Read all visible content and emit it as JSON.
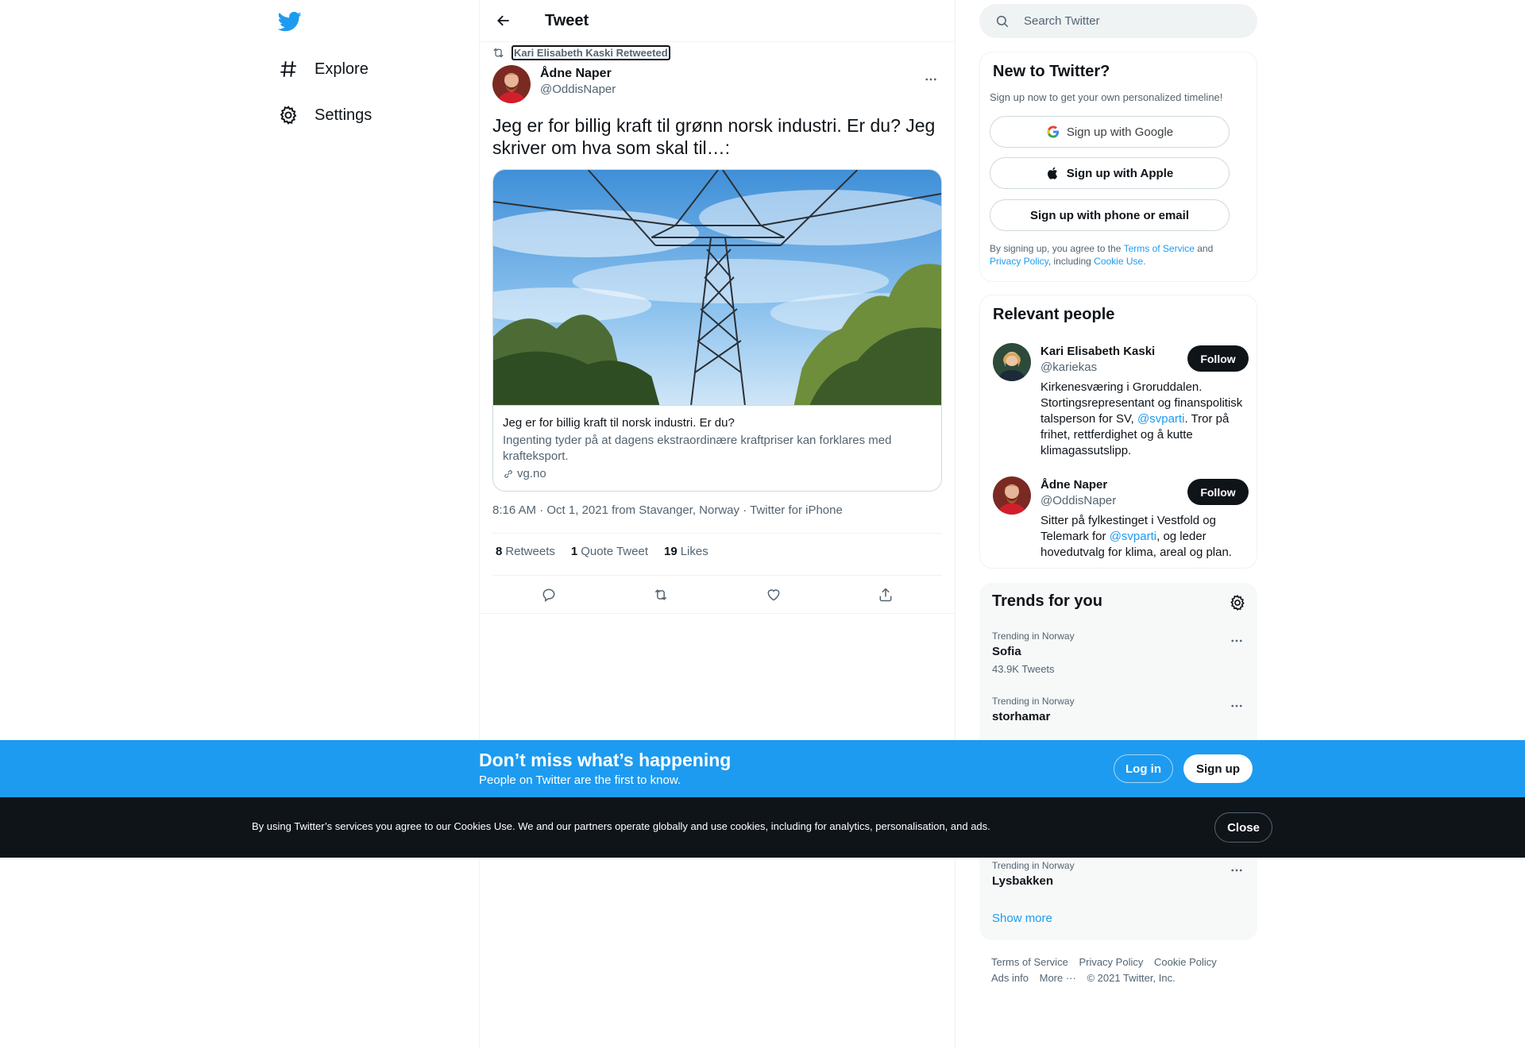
{
  "nav": {
    "explore": "Explore",
    "settings": "Settings"
  },
  "header": {
    "title": "Tweet"
  },
  "tweet": {
    "retweeted_by": "Kari Elisabeth Kaski Retweeted",
    "author_name": "Ådne Naper",
    "author_handle": "@OddisNaper",
    "text": "Jeg er for billig kraft til grønn norsk industri. Er du? Jeg skriver om hva som skal til…:",
    "card": {
      "title": "Jeg er for billig kraft til norsk industri. Er du?",
      "description": "Ingenting tyder på at dagens ekstraordinære kraftpriser kan forklares med krafteksport.",
      "domain": "vg.no"
    },
    "meta": {
      "time": "8:16 AM",
      "date": "Oct 1, 2021",
      "location": "from Stavanger, Norway",
      "source": "Twitter for iPhone",
      "sep": "·"
    },
    "stats": {
      "retweets_count": "8",
      "retweets_label": "Retweets",
      "quotes_count": "1",
      "quotes_label": "Quote Tweet",
      "likes_count": "19",
      "likes_label": "Likes"
    }
  },
  "search": {
    "placeholder": "Search Twitter"
  },
  "new_to_twitter": {
    "title": "New to Twitter?",
    "subtitle": "Sign up now to get your own personalized timeline!",
    "google": "Sign up with Google",
    "apple": "Sign up with Apple",
    "phone": "Sign up with phone or email",
    "legal_1": "By signing up, you agree to the ",
    "tos": "Terms of Service",
    "legal_2": " and ",
    "privacy": "Privacy Policy",
    "legal_3": ", including ",
    "cookie": "Cookie Use."
  },
  "relevant": {
    "title": "Relevant people",
    "people": [
      {
        "name": "Kari Elisabeth Kaski",
        "handle": "@kariekas",
        "bio_1": "Kirkenesværing i Groruddalen. Stortingsrepresentant og finanspolitisk talsperson for SV, ",
        "mention": "@svparti",
        "bio_2": ". Tror på frihet, rettferdighet og å kutte klimagassutslipp.",
        "follow": "Follow"
      },
      {
        "name": "Ådne Naper",
        "handle": "@OddisNaper",
        "bio_1": "Sitter på fylkestinget i Vestfold og Telemark for ",
        "mention": "@svparti",
        "bio_2": ", og leder hovedutvalg for klima, areal og plan.",
        "follow": "Follow"
      }
    ]
  },
  "trends": {
    "title": "Trends for you",
    "items": [
      {
        "context": "Trending in Norway",
        "name": "Sofia",
        "count": "43.9K Tweets"
      },
      {
        "context": "Trending in Norway",
        "name": "storhamar"
      },
      {
        "context": "Trending in Norway",
        "name": "Lysbakken"
      }
    ],
    "show_more": "Show more"
  },
  "footer": {
    "terms": "Terms of Service",
    "privacy": "Privacy Policy",
    "cookie": "Cookie Policy",
    "ads": "Ads info",
    "more": "More ···",
    "copyright": "© 2021 Twitter, Inc."
  },
  "signup_bar": {
    "title": "Don’t miss what’s happening",
    "subtitle": "People on Twitter are the first to know.",
    "login": "Log in",
    "signup": "Sign up"
  },
  "cookie_bar": {
    "text": "By using Twitter’s services you agree to our Cookies Use. We and our partners operate globally and use cookies, including for analytics, personalisation, and ads.",
    "close": "Close"
  },
  "colors": {
    "brand": "#1d9bf0",
    "text": "#0f1419",
    "muted": "#536471",
    "dark_bar": "#0f1419"
  }
}
